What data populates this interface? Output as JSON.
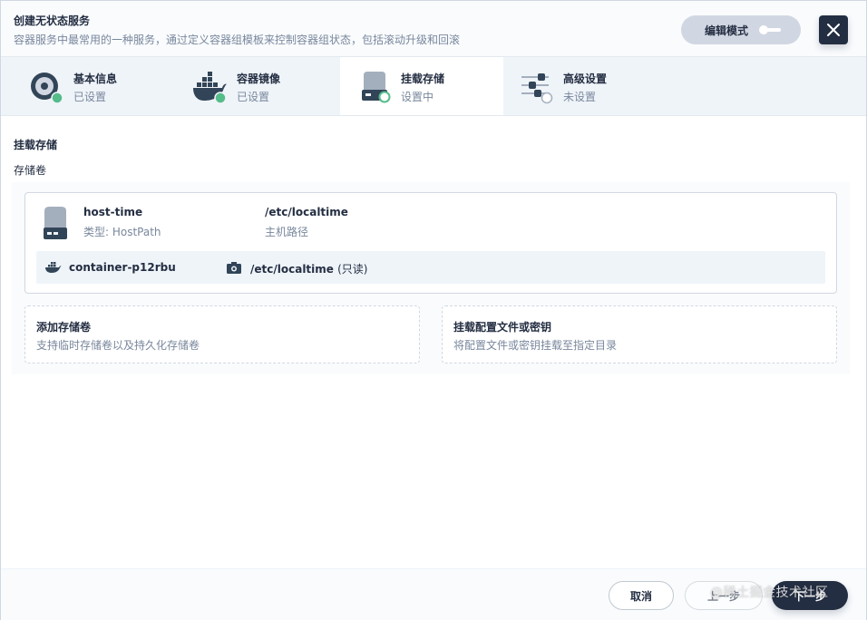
{
  "header": {
    "title": "创建无状态服务",
    "description": "容器服务中最常用的一种服务，通过定义容器组模板来控制容器组状态，包括滚动升级和回滚",
    "edit_mode_label": "编辑模式"
  },
  "tabs": [
    {
      "name": "基本信息",
      "status": "已设置",
      "icon": "disc-icon"
    },
    {
      "name": "容器镜像",
      "status": "已设置",
      "icon": "docker-icon"
    },
    {
      "name": "挂载存储",
      "status": "设置中",
      "icon": "storage-icon"
    },
    {
      "name": "高级设置",
      "status": "未设置",
      "icon": "sliders-icon"
    }
  ],
  "content": {
    "section_title": "挂载存储",
    "section_subtitle": "存储卷",
    "volume": {
      "name": "host-time",
      "type": "类型: HostPath",
      "path": "/etc/localtime",
      "path_label": "主机路径",
      "mount": {
        "container": "container-p12rbu",
        "path": "/etc/localtime",
        "mode": "(只读)"
      }
    },
    "add_volume": {
      "title": "添加存储卷",
      "desc": "支持临时存储卷以及持久化存储卷"
    },
    "mount_config": {
      "title": "挂载配置文件或密钥",
      "desc": "将配置文件或密钥挂载至指定目录"
    }
  },
  "footer": {
    "cancel": "取消",
    "prev": "上一步",
    "next": "下一步"
  },
  "watermark": "@稀土掘金技术社区",
  "colors": {
    "primary_dark": "#242e42",
    "success_green": "#55bc8a",
    "muted_text": "#79879c",
    "border": "#d1d7e2"
  }
}
